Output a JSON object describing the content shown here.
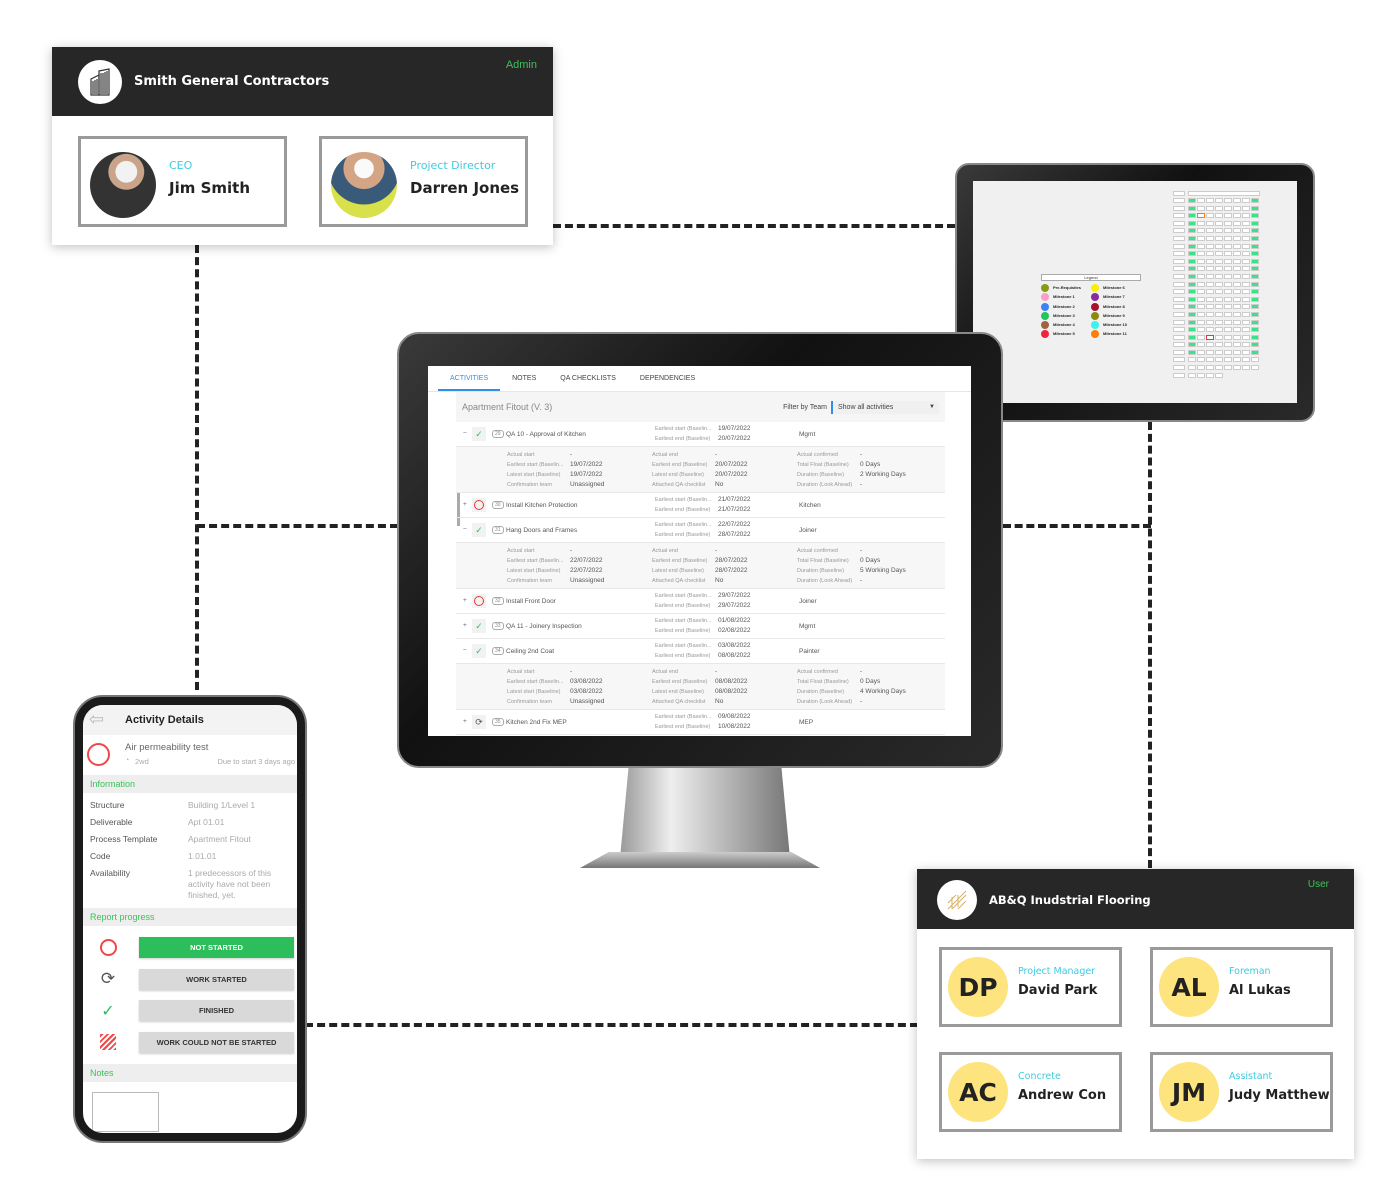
{
  "contractor_card": {
    "org_name": "Smith General Contractors",
    "role": "Admin",
    "people": [
      {
        "role": "CEO",
        "name": "Jim Smith"
      },
      {
        "role": "Project Director",
        "name": "Darren Jones"
      }
    ]
  },
  "subcontractor_card": {
    "org_name": "AB&Q Inudstrial Flooring",
    "role": "User",
    "people": [
      {
        "initials": "DP",
        "role": "Project Manager",
        "name": "David Park"
      },
      {
        "initials": "AL",
        "role": "Foreman",
        "name": "Al Lukas"
      },
      {
        "initials": "AC",
        "role": "Concrete",
        "name": "Andrew Con"
      },
      {
        "initials": "JM",
        "role": "Assistant",
        "name": "Judy Matthew"
      }
    ]
  },
  "desktop": {
    "tabs": [
      {
        "label": "ACTIVITIES",
        "active": true
      },
      {
        "label": "NOTES"
      },
      {
        "label": "QA CHECKLISTS"
      },
      {
        "label": "DEPENDENCIES"
      }
    ],
    "project_title": "Apartment Fitout (V. 3)",
    "filter_label": "Filter by Team",
    "filter_value": "Show all activities",
    "row_labels": {
      "earliest_start": "Earliest start (Baselin...",
      "earliest_end": "Earliest end (Baseline)"
    },
    "detail_labels": {
      "actual_start": "Actual start",
      "earliest_start": "Earliest start (Baselin...",
      "latest_start": "Latest start (Baseline)",
      "confirmation_team": "Confirmation team",
      "actual_end": "Actual end",
      "earliest_end": "Earliest end (Baseline)",
      "latest_end": "Latest end (Baseline)",
      "qa_checklist": "Attached QA checklist",
      "actual_confirmed": "Actual confirmed",
      "total_float": "Total Float (Baseline)",
      "duration": "Duration (Baseline)",
      "duration_lookahead": "Duration (Look Ahead)"
    },
    "activities": [
      {
        "id": "29",
        "name": "QA 10 - Approval of Kitchen",
        "status": "finished",
        "expanded": true,
        "earliest_start": "19/07/2022",
        "earliest_end": "20/07/2022",
        "team": "Mgmt",
        "detail": {
          "actual_start": "-",
          "earliest_start": "19/07/2022",
          "latest_start": "19/07/2022",
          "confirmation_team": "Unassigned",
          "actual_end": "-",
          "earliest_end": "20/07/2022",
          "latest_end": "20/07/2022",
          "qa_checklist": "No",
          "actual_confirmed": "-",
          "total_float": "0 Days",
          "duration": "2 Working Days",
          "duration_lookahead": "-"
        }
      },
      {
        "id": "30",
        "name": "Install Kitchen Protection",
        "status": "not-started",
        "expanded": false,
        "earliest_start": "21/07/2022",
        "earliest_end": "21/07/2022",
        "team": "Kitchen"
      },
      {
        "id": "31",
        "name": "Hang Doors and Frames",
        "status": "finished",
        "expanded": true,
        "earliest_start": "22/07/2022",
        "earliest_end": "28/07/2022",
        "team": "Joiner",
        "detail": {
          "actual_start": "-",
          "earliest_start": "22/07/2022",
          "latest_start": "22/07/2022",
          "confirmation_team": "Unassigned",
          "actual_end": "-",
          "earliest_end": "28/07/2022",
          "latest_end": "28/07/2022",
          "qa_checklist": "No",
          "actual_confirmed": "-",
          "total_float": "0 Days",
          "duration": "5 Working Days",
          "duration_lookahead": "-"
        }
      },
      {
        "id": "32",
        "name": "Install Front Door",
        "status": "not-started",
        "expanded": false,
        "earliest_start": "29/07/2022",
        "earliest_end": "29/07/2022",
        "team": "Joiner"
      },
      {
        "id": "33",
        "name": "QA 11 - Joinery Inspection",
        "status": "finished",
        "expanded": false,
        "earliest_start": "01/08/2022",
        "earliest_end": "02/08/2022",
        "team": "Mgmt"
      },
      {
        "id": "34",
        "name": "Ceiling 2nd Coat",
        "status": "finished",
        "expanded": true,
        "earliest_start": "03/08/2022",
        "earliest_end": "08/08/2022",
        "team": "Painter",
        "detail": {
          "actual_start": "-",
          "earliest_start": "03/08/2022",
          "latest_start": "03/08/2022",
          "confirmation_team": "Unassigned",
          "actual_end": "-",
          "earliest_end": "08/08/2022",
          "latest_end": "08/08/2022",
          "qa_checklist": "No",
          "actual_confirmed": "-",
          "total_float": "0 Days",
          "duration": "4 Working Days",
          "duration_lookahead": "-"
        }
      },
      {
        "id": "35",
        "name": "Kitchen 2nd Fix MEP",
        "status": "in-progress",
        "expanded": false,
        "earliest_start": "09/08/2022",
        "earliest_end": "10/08/2022",
        "team": "MEP"
      }
    ]
  },
  "tablet": {
    "legend_title": "Legend",
    "legend": [
      {
        "label": "Pre-Requisites",
        "color": "#8a9a12"
      },
      {
        "label": "Milestone 1",
        "color": "#f7a1c4"
      },
      {
        "label": "Milestone 2",
        "color": "#3b82f6"
      },
      {
        "label": "Milestone 3",
        "color": "#22c55e"
      },
      {
        "label": "Milestone 4",
        "color": "#a0623f"
      },
      {
        "label": "Milestone 5",
        "color": "#ef233c"
      },
      {
        "label": "Milestone 6",
        "color": "#f5f00a"
      },
      {
        "label": "Milestone 7",
        "color": "#8e2a9c"
      },
      {
        "label": "Milestone 8",
        "color": "#a3122e"
      },
      {
        "label": "Milestone 9",
        "color": "#8a8a10"
      },
      {
        "label": "Milestone 10",
        "color": "#3ef0f0"
      },
      {
        "label": "Milestone 11",
        "color": "#f97f0a"
      }
    ]
  },
  "phone": {
    "title": "Activity Details",
    "activity_name": "Air permeability test",
    "duration": "2wd",
    "due": "Due to start 3 days ago",
    "information_label": "Information",
    "info": [
      {
        "key": "Structure",
        "value": "Building 1/Level 1"
      },
      {
        "key": "Deliverable",
        "value": "Apt 01.01"
      },
      {
        "key": "Process Template",
        "value": "Apartment Fitout"
      },
      {
        "key": "Code",
        "value": "1.01.01"
      },
      {
        "key": "Availability",
        "value": "1 predecessors of this activity have not been finished, yet."
      }
    ],
    "report_label": "Report progress",
    "progress_options": [
      {
        "label": "NOT STARTED",
        "icon": "circle-icon",
        "selected": true
      },
      {
        "label": "WORK STARTED",
        "icon": "refresh-icon"
      },
      {
        "label": "FINISHED",
        "icon": "check-icon"
      },
      {
        "label": "WORK COULD NOT BE STARTED",
        "icon": "hatched-icon"
      }
    ],
    "notes_label": "Notes"
  },
  "colors": {
    "green": "#2dbe5c",
    "accent_blue": "#2f8fe8",
    "role_cyan": "#3fcbe0",
    "header_dark": "#272727",
    "avatar_yellow": "#fde47f"
  }
}
